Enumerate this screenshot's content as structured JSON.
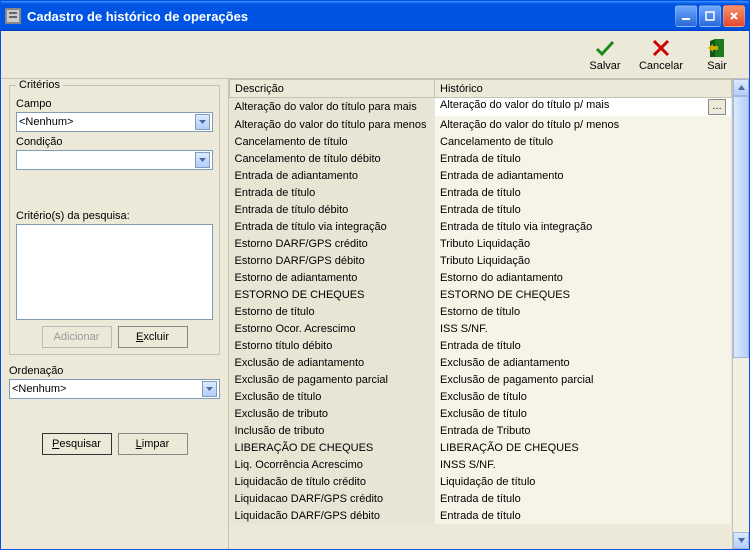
{
  "window": {
    "title": "Cadastro de histórico de operações"
  },
  "toolbar": {
    "save": "Salvar",
    "cancel": "Cancelar",
    "exit": "Sair"
  },
  "criteria": {
    "group_title": "Critérios",
    "campo_label": "Campo",
    "campo_value": "<Nenhum>",
    "condicao_label": "Condição",
    "condicao_value": "",
    "list_label": "Critério(s) da pesquisa:",
    "add_label": "Adicionar",
    "remove_label": "Excluir"
  },
  "ordering": {
    "label": "Ordenação",
    "value": "<Nenhum>"
  },
  "actions": {
    "search": "Pesquisar",
    "clear": "Limpar"
  },
  "grid": {
    "col_desc": "Descrição",
    "col_hist": "Histórico",
    "rows": [
      {
        "d": "Alteração do valor do título para mais",
        "h": "Alteração do valor do título p/ mais"
      },
      {
        "d": "Alteração do valor do título para menos",
        "h": "Alteração do valor do título p/ menos"
      },
      {
        "d": "Cancelamento de título",
        "h": "Cancelamento de título"
      },
      {
        "d": "Cancelamento de título débito",
        "h": "Entrada de título"
      },
      {
        "d": "Entrada de adiantamento",
        "h": "Entrada de adiantamento"
      },
      {
        "d": "Entrada de título",
        "h": "Entrada de título"
      },
      {
        "d": "Entrada de título débito",
        "h": "Entrada de título"
      },
      {
        "d": "Entrada de título via integração",
        "h": "Entrada de título via integração"
      },
      {
        "d": "Estorno DARF/GPS crédito",
        "h": "Tributo Liquidação"
      },
      {
        "d": "Estorno DARF/GPS débito",
        "h": "Tributo Liquidação"
      },
      {
        "d": "Estorno de adiantamento",
        "h": "Estorno do adiantamento"
      },
      {
        "d": "ESTORNO DE CHEQUES",
        "h": "ESTORNO DE CHEQUES"
      },
      {
        "d": "Estorno de título",
        "h": "Estorno de título"
      },
      {
        "d": "Estorno Ocor. Acrescimo",
        "h": "ISS S/NF."
      },
      {
        "d": "Estorno título débito",
        "h": "Entrada de título"
      },
      {
        "d": "Exclusão de adiantamento",
        "h": "Exclusão de adiantamento"
      },
      {
        "d": "Exclusão de pagamento parcial",
        "h": "Exclusão de pagamento parcial"
      },
      {
        "d": "Exclusão de título",
        "h": "Exclusão de título"
      },
      {
        "d": "Exclusão de tributo",
        "h": "Exclusão de título"
      },
      {
        "d": "Inclusão de tributo",
        "h": "Entrada de Tributo"
      },
      {
        "d": "LIBERAÇÃO DE CHEQUES",
        "h": "LIBERAÇÃO DE CHEQUES"
      },
      {
        "d": "Liq. Ocorrência Acrescimo",
        "h": "INSS S/NF."
      },
      {
        "d": "Liquidacão de título crédito",
        "h": "Liquidação de título"
      },
      {
        "d": "Liquidacao DARF/GPS crédito",
        "h": "Entrada de título"
      },
      {
        "d": "Liquidacão DARF/GPS débito",
        "h": "Entrada de título"
      }
    ]
  }
}
